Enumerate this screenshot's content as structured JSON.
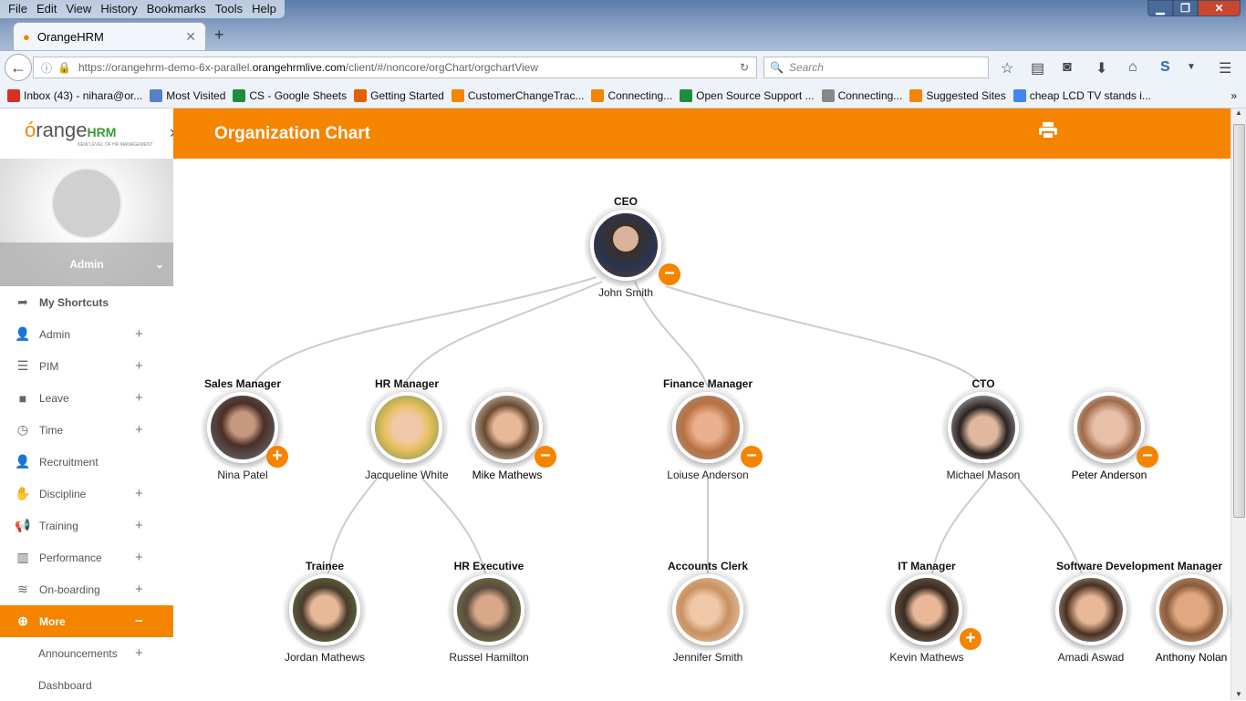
{
  "browser": {
    "menu": [
      "File",
      "Edit",
      "View",
      "History",
      "Bookmarks",
      "Tools",
      "Help"
    ],
    "tab_title": "OrangeHRM",
    "url_prefix": "https://orangehrm-demo-6x-parallel.",
    "url_domain": "orangehrmlive.com",
    "url_suffix": "/client/#/noncore/orgChart/orgchartView",
    "search_placeholder": "Search",
    "bookmarks": [
      "Inbox (43) - nihara@or...",
      "Most Visited",
      "CS - Google Sheets",
      "Getting Started",
      "CustomerChangeTrac...",
      "Connecting...",
      "Open Source Support ...",
      "Connecting...",
      "Suggested Sites",
      "cheap LCD TV stands i..."
    ],
    "bookmark_colors": [
      "#d93025",
      "#5b7fc7",
      "#1e8e3e",
      "#e66000",
      "#f58400",
      "#f58400",
      "#1e8e3e",
      "#888888",
      "#f58400",
      "#4285f4"
    ]
  },
  "app": {
    "logo_text": "orangeHRM",
    "logo_tagline": "NEW LEVEL OF HR MANAGEMENT",
    "user": "Admin",
    "page_title": "Organization Chart",
    "accent": "#f58400",
    "nav": [
      {
        "label": "My Shortcuts",
        "icon": "➦",
        "plus": ""
      },
      {
        "label": "Admin",
        "icon": "👤",
        "plus": "+"
      },
      {
        "label": "PIM",
        "icon": "☰",
        "plus": "+"
      },
      {
        "label": "Leave",
        "icon": "■",
        "plus": "+"
      },
      {
        "label": "Time",
        "icon": "◷",
        "plus": "+"
      },
      {
        "label": "Recruitment",
        "icon": "👤",
        "plus": ""
      },
      {
        "label": "Discipline",
        "icon": "✋",
        "plus": "+"
      },
      {
        "label": "Training",
        "icon": "📢",
        "plus": "+"
      },
      {
        "label": "Performance",
        "icon": "▥",
        "plus": "+"
      },
      {
        "label": "On-boarding",
        "icon": "≋",
        "plus": "+"
      },
      {
        "label": "More",
        "icon": "⊕",
        "plus": "−"
      },
      {
        "label": "Announcements",
        "icon": "",
        "plus": "+"
      },
      {
        "label": "Dashboard",
        "icon": "",
        "plus": ""
      }
    ]
  },
  "org": {
    "ceo": {
      "title": "CEO",
      "name": "John Smith",
      "toggle": "−"
    },
    "sales": {
      "title": "Sales Manager",
      "name": "Nina Patel",
      "toggle": "+"
    },
    "hr": {
      "title": "HR Manager",
      "name": "Jacqueline White"
    },
    "hr2": {
      "name": "Mike Mathews",
      "toggle": "−"
    },
    "fin": {
      "title": "Finance Manager",
      "name": "Loiuse Anderson",
      "toggle": "−"
    },
    "cto": {
      "title": "CTO",
      "name": "Michael Mason"
    },
    "cto2": {
      "name": "Peter Anderson",
      "toggle": "−"
    },
    "trainee": {
      "title": "Trainee",
      "name": "Jordan Mathews"
    },
    "hrexec": {
      "title": "HR Executive",
      "name": "Russel Hamilton"
    },
    "clerk": {
      "title": "Accounts Clerk",
      "name": "Jennifer Smith"
    },
    "itm": {
      "title": "IT Manager",
      "name": "Kevin Mathews",
      "toggle": "+"
    },
    "sdm": {
      "title": "Software Development Manager",
      "name": "Amadi Aswad"
    },
    "sdm2": {
      "name": "Anthony Nolan"
    }
  }
}
